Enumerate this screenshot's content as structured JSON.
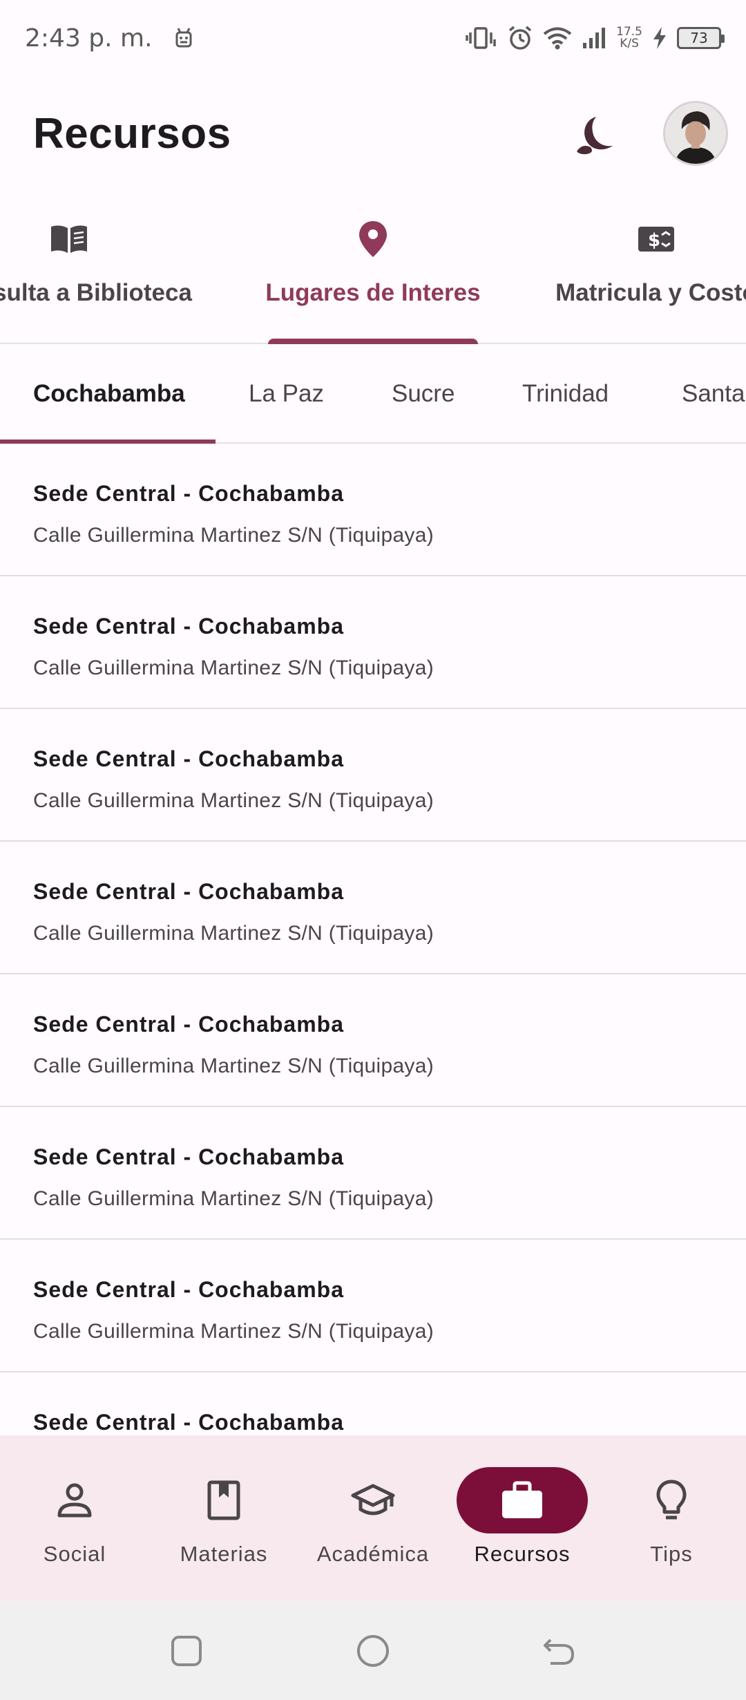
{
  "status_bar": {
    "time": "2:43 p. m.",
    "net_speed_value": "17.5",
    "net_speed_unit": "K/S",
    "battery": "73"
  },
  "header": {
    "title": "Recursos"
  },
  "primary_tabs": [
    {
      "label": "Consulta a Biblioteca",
      "icon": "book-open-icon"
    },
    {
      "label": "Lugares de Interes",
      "icon": "location-pin-icon"
    },
    {
      "label": "Matricula y Costo",
      "icon": "money-icon"
    }
  ],
  "secondary_tabs": [
    {
      "label": "Cochabamba"
    },
    {
      "label": "La Paz"
    },
    {
      "label": "Sucre"
    },
    {
      "label": "Trinidad"
    },
    {
      "label": "Santa"
    }
  ],
  "places": [
    {
      "title": "Sede Central - Cochabamba",
      "address": "Calle Guillermina Martinez S/N (Tiquipaya)"
    },
    {
      "title": "Sede Central - Cochabamba",
      "address": "Calle Guillermina Martinez S/N (Tiquipaya)"
    },
    {
      "title": "Sede Central - Cochabamba",
      "address": "Calle Guillermina Martinez S/N (Tiquipaya)"
    },
    {
      "title": "Sede Central - Cochabamba",
      "address": "Calle Guillermina Martinez S/N (Tiquipaya)"
    },
    {
      "title": "Sede Central - Cochabamba",
      "address": "Calle Guillermina Martinez S/N (Tiquipaya)"
    },
    {
      "title": "Sede Central - Cochabamba",
      "address": "Calle Guillermina Martinez S/N (Tiquipaya)"
    },
    {
      "title": "Sede Central - Cochabamba",
      "address": "Calle Guillermina Martinez S/N (Tiquipaya)"
    },
    {
      "title": "Sede Central - Cochabamba",
      "address": ""
    }
  ],
  "bottom_nav": [
    {
      "label": "Social",
      "icon": "person-icon"
    },
    {
      "label": "Materias",
      "icon": "notebook-icon"
    },
    {
      "label": "Académica",
      "icon": "graduation-cap-icon"
    },
    {
      "label": "Recursos",
      "icon": "briefcase-icon"
    },
    {
      "label": "Tips",
      "icon": "lightbulb-icon"
    }
  ],
  "colors": {
    "accent": "#8f3a5a",
    "nav_active": "#7c0f3a",
    "nav_background": "#f7e9ee"
  }
}
